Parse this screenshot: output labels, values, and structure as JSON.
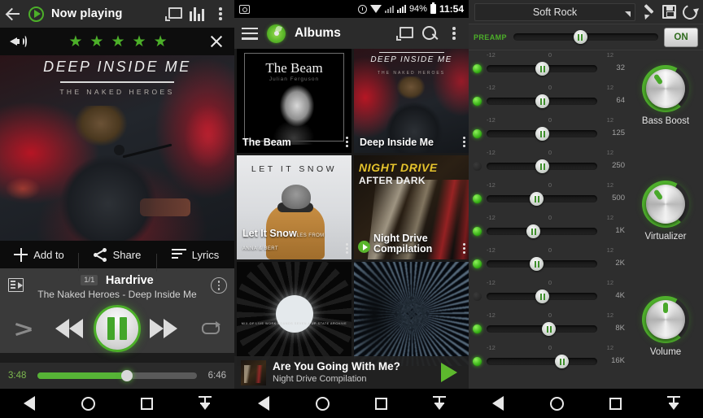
{
  "panel1": {
    "topbar": {
      "title": "Now playing",
      "back_icon": "back-arrow-icon",
      "logo_icon": "play-logo-icon",
      "cast_icon": "cast-icon",
      "eq_icon": "equalizer-icon",
      "overflow_icon": "overflow-menu-icon"
    },
    "rating": {
      "volume_icon": "volume-icon",
      "stars": 5,
      "star_glyph": "★",
      "close_icon": "close-icon"
    },
    "artwork": {
      "album_title": "DEEP INSIDE ME",
      "album_artist": "THE NAKED HEROES"
    },
    "actions": [
      {
        "label": "Add to",
        "icon": "plus-icon"
      },
      {
        "label": "Share",
        "icon": "share-icon"
      },
      {
        "label": "Lyrics",
        "icon": "lyrics-icon"
      }
    ],
    "meta": {
      "queue_icon": "queue-icon",
      "position": "1/1",
      "track": "Hardrive",
      "subtitle": "The Naked Heroes - Deep Inside Me",
      "overflow_icon": "overflow-menu-icon"
    },
    "controls": {
      "shuffle_icon": "shuffle-icon",
      "previous_icon": "previous-track-icon",
      "pause_icon": "pause-icon",
      "next_icon": "next-track-icon",
      "repeat_icon": "repeat-icon"
    },
    "seek": {
      "elapsed": "3:48",
      "duration": "6:46",
      "progress_pct": 56
    }
  },
  "panel2": {
    "statusbar": {
      "camera_icon": "camera-icon",
      "alarm_icon": "alarm-icon",
      "wifi_icon": "wifi-icon",
      "signal_icon": "signal-icon",
      "signal2_icon": "signal-icon",
      "battery_pct": "94%",
      "battery_icon": "battery-icon",
      "time": "11:54"
    },
    "topbar": {
      "menu_icon": "hamburger-menu-icon",
      "logo_icon": "disc-logo-icon",
      "title": "Albums",
      "cast_icon": "cast-icon",
      "search_icon": "search-icon",
      "overflow_icon": "overflow-menu-icon"
    },
    "albums": [
      {
        "title": "The Beam",
        "art_title": "The Beam",
        "art_sub": "Julian Ferguson",
        "overflow_icon": "overflow-menu-icon"
      },
      {
        "title": "Deep Inside Me",
        "art_title": "DEEP INSIDE ME",
        "art_sub": "THE NAKED HEROES",
        "overflow_icon": "overflow-menu-icon"
      },
      {
        "title": "Let It Snow",
        "title_sub": "LES FROM ANNA & BERT",
        "art_title": "LET IT SNOW",
        "overflow_icon": "overflow-menu-icon"
      },
      {
        "title": "Night Drive",
        "title2": "Compilation",
        "art_title": "NIGHT DRIVE",
        "art_title2": "AFTER DARK",
        "play_icon": "play-icon",
        "overflow_icon": "overflow-menu-icon"
      },
      {
        "title": "",
        "art_sub": "MIX OF LIVE WORK SOUNDS SEVEN A UP STATE ARCHIVE"
      },
      {
        "title": ""
      }
    ],
    "mini_player": {
      "track": "Are You Going With Me?",
      "album": "Night Drive Compilation",
      "play_icon": "play-icon"
    }
  },
  "panel3": {
    "topbar": {
      "preset": "Soft Rock",
      "caret_icon": "chevron-down-icon",
      "edit_icon": "pencil-icon",
      "save_icon": "save-icon",
      "reset_icon": "reset-icon"
    },
    "preamp": {
      "label": "PREAMP",
      "value_pct": 46,
      "toggle_label": "ON"
    },
    "tick_labels": [
      "-12",
      "0",
      "12"
    ],
    "bands": [
      {
        "freq": "32",
        "pos_pct": 50,
        "led": true
      },
      {
        "freq": "64",
        "pos_pct": 50,
        "led": true
      },
      {
        "freq": "125",
        "pos_pct": 50,
        "led": true
      },
      {
        "freq": "250",
        "pos_pct": 50,
        "led": false
      },
      {
        "freq": "500",
        "pos_pct": 45,
        "led": true
      },
      {
        "freq": "1K",
        "pos_pct": 42,
        "led": true
      },
      {
        "freq": "2K",
        "pos_pct": 45,
        "led": true
      },
      {
        "freq": "4K",
        "pos_pct": 50,
        "led": false
      },
      {
        "freq": "8K",
        "pos_pct": 56,
        "led": true
      },
      {
        "freq": "16K",
        "pos_pct": 68,
        "led": true
      }
    ],
    "knobs": [
      {
        "label": "Bass Boost",
        "angle": -35
      },
      {
        "label": "Virtualizer",
        "angle": -35
      },
      {
        "label": "Volume",
        "angle": 0
      }
    ]
  },
  "navbar": {
    "back_icon": "nav-back-icon",
    "home_icon": "nav-home-icon",
    "recents_icon": "nav-recents-icon",
    "download_icon": "nav-download-icon"
  }
}
